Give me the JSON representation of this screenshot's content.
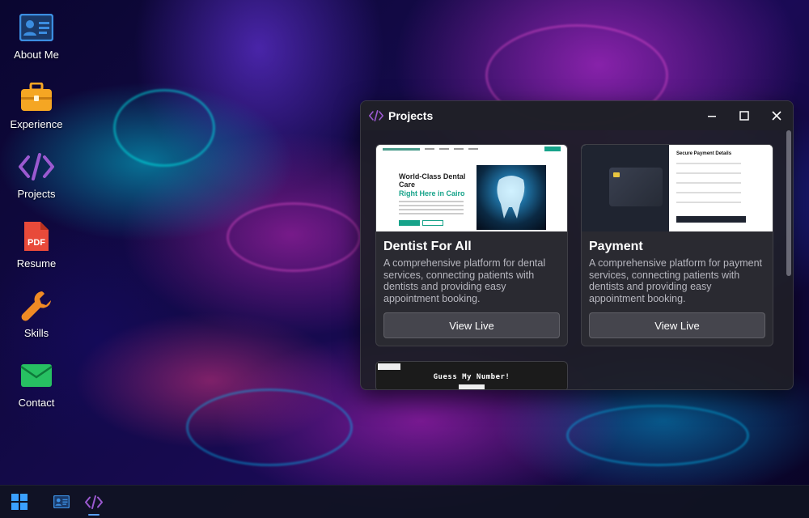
{
  "desktop": {
    "icons": [
      {
        "label": "About Me",
        "icon": "id-card-icon"
      },
      {
        "label": "Experience",
        "icon": "briefcase-icon"
      },
      {
        "label": "Projects",
        "icon": "code-icon"
      },
      {
        "label": "Resume",
        "icon": "pdf-icon"
      },
      {
        "label": "Skills",
        "icon": "wrench-icon"
      },
      {
        "label": "Contact",
        "icon": "envelope-icon"
      }
    ]
  },
  "window": {
    "title": "Projects",
    "controls": {
      "minimize": "—",
      "maximize": "☐",
      "close": "✕"
    },
    "cards": [
      {
        "title": "Dentist For All",
        "description": "A comprehensive platform for dental services, connecting patients with dentists and providing easy appointment booking.",
        "button": "View Live",
        "preview": {
          "heading": "World-Class Dental Care",
          "highlight": "Right Here in Cairo"
        }
      },
      {
        "title": "Payment",
        "description": "A comprehensive platform for payment services, connecting patients with dentists and providing easy appointment booking.",
        "button": "View Live",
        "preview": {
          "heading": "Secure Payment Details"
        }
      },
      {
        "title": "",
        "preview": {
          "heading": "Guess My Number!"
        }
      }
    ]
  },
  "colors": {
    "accent": "#5aa0ff",
    "briefcase": "#f5a623",
    "code": "#9b59d0",
    "pdf": "#e84a3a",
    "wrench": "#f08a24",
    "envelope": "#27c062",
    "idcard": "#3b8de0"
  }
}
